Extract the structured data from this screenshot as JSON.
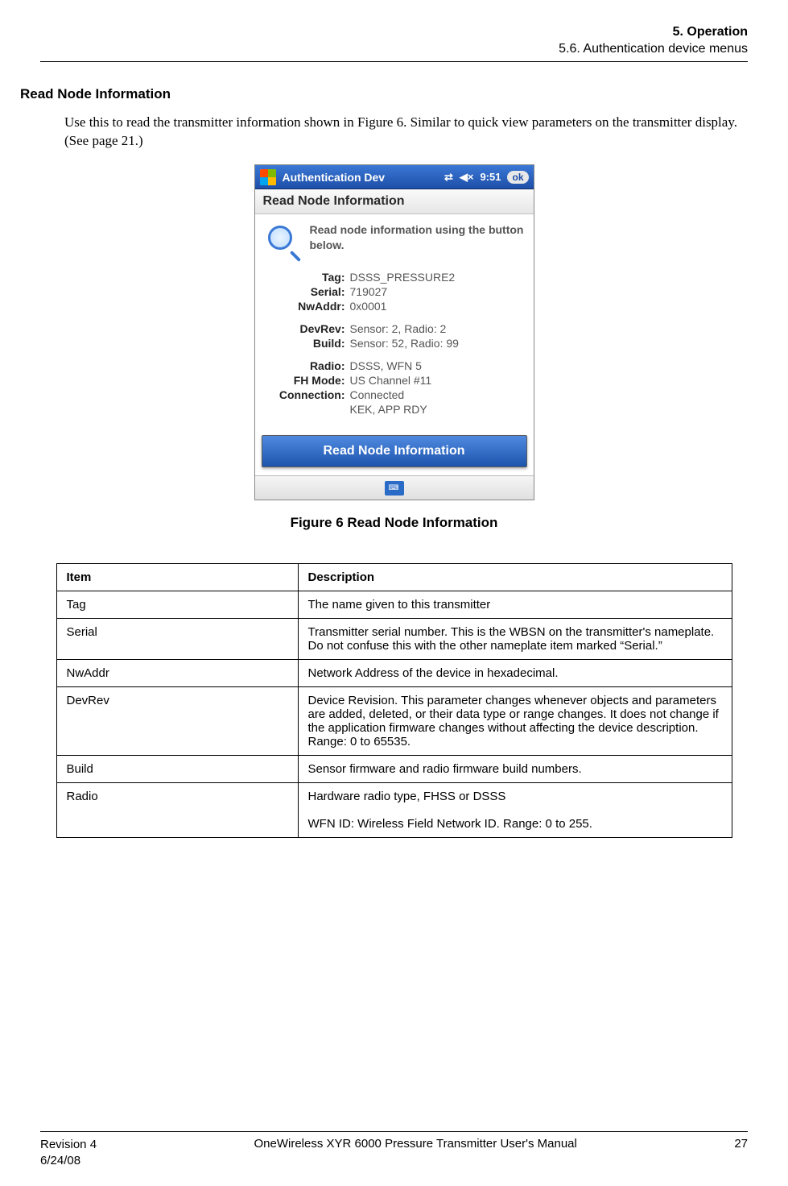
{
  "header": {
    "chapter": "5. Operation",
    "section": "5.6. Authentication device menus"
  },
  "heading": "Read Node Information",
  "body_paragraph": "Use this to read the transmitter information shown in Figure 6. Similar to quick view parameters on the transmitter display. (See page 21.)",
  "device": {
    "titlebar": {
      "app_title": "Authentication Dev",
      "time": "9:51",
      "ok": "ok"
    },
    "panel_title": "Read Node Information",
    "hint": "Read node information using the button below.",
    "fields": {
      "tag_label": "Tag:",
      "tag_value": "DSSS_PRESSURE2",
      "serial_label": "Serial:",
      "serial_value": "719027",
      "nwaddr_label": "NwAddr:",
      "nwaddr_value": "0x0001",
      "devrev_label": "DevRev:",
      "devrev_value": "Sensor: 2, Radio: 2",
      "build_label": "Build:",
      "build_value": "Sensor: 52, Radio: 99",
      "radio_label": "Radio:",
      "radio_value": "DSSS, WFN 5",
      "fh_label": "FH Mode:",
      "fh_value": "US Channel #11",
      "conn_label": "Connection:",
      "conn_value": "Connected",
      "conn_extra": "KEK, APP RDY"
    },
    "button_label": "Read Node Information"
  },
  "figure_caption": "Figure 6 Read Node Information",
  "table": {
    "headers": {
      "item": "Item",
      "desc": "Description"
    },
    "rows": [
      {
        "item": "Tag",
        "desc": "The name given to this transmitter"
      },
      {
        "item": "Serial",
        "desc": "Transmitter serial number. This is the WBSN on the transmitter's nameplate. Do not confuse this with the other nameplate item marked “Serial.”"
      },
      {
        "item": "NwAddr",
        "desc": "Network Address of the device in hexadecimal."
      },
      {
        "item": "DevRev",
        "desc": "Device Revision. This parameter changes whenever objects and parameters are added, deleted, or their data type or range changes. It does not change if the application firmware changes without affecting the device description. Range: 0 to 65535."
      },
      {
        "item": "Build",
        "desc": "Sensor firmware and radio firmware build numbers."
      },
      {
        "item": "Radio",
        "desc": "Hardware radio type, FHSS or DSSS\n\nWFN ID: Wireless Field Network ID. Range: 0 to 255."
      }
    ]
  },
  "footer": {
    "revision": "Revision 4",
    "date": "6/24/08",
    "manual_title": "OneWireless XYR 6000 Pressure Transmitter User's Manual",
    "page_number": "27"
  }
}
